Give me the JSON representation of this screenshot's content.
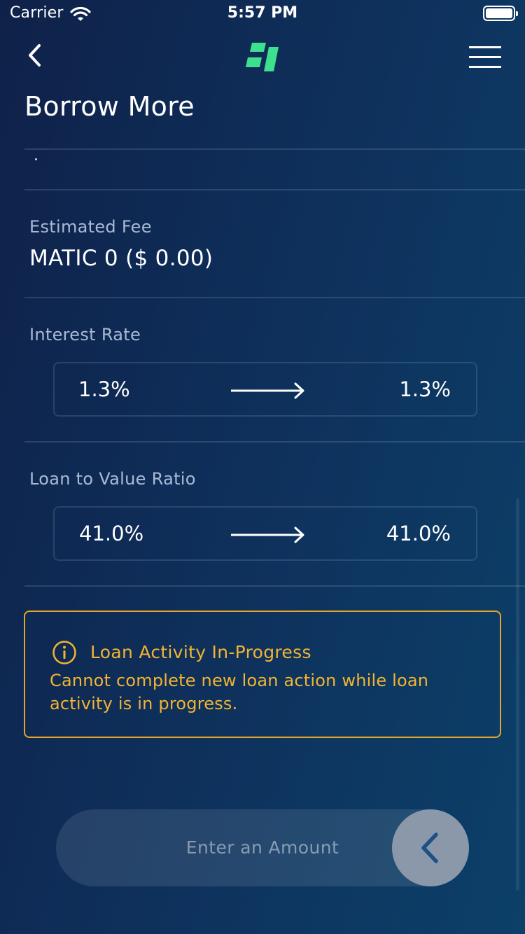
{
  "status_bar": {
    "carrier": "Carrier",
    "time": "5:57 PM"
  },
  "nav": {
    "back_icon": "chevron-left-icon",
    "logo_icon": "brand-logo-icon",
    "menu_icon": "hamburger-menu-icon"
  },
  "page": {
    "title": "Borrow More"
  },
  "estimated_fee": {
    "label": "Estimated Fee",
    "value": "MATIC 0 ($ 0.00)"
  },
  "interest_rate": {
    "label": "Interest Rate",
    "from": "1.3%",
    "to": "1.3%"
  },
  "loan_to_value": {
    "label": "Loan to Value Ratio",
    "from": "41.0%",
    "to": "41.0%"
  },
  "warning": {
    "icon": "info-icon",
    "title": "Loan Activity In-Progress",
    "message": "Cannot complete new loan action while loan activity is in progress."
  },
  "slider": {
    "label": "Enter an Amount",
    "knob_icon": "chevron-left-icon"
  },
  "colors": {
    "background_start": "#0f2149",
    "background_end": "#0c4069",
    "label": "#a9bad4",
    "warning": "#f2b431",
    "warning_border": "#e5a52b",
    "logo_green": "#3de08f",
    "knob": "#8a98a9",
    "knob_chevron": "#1e4f86"
  }
}
